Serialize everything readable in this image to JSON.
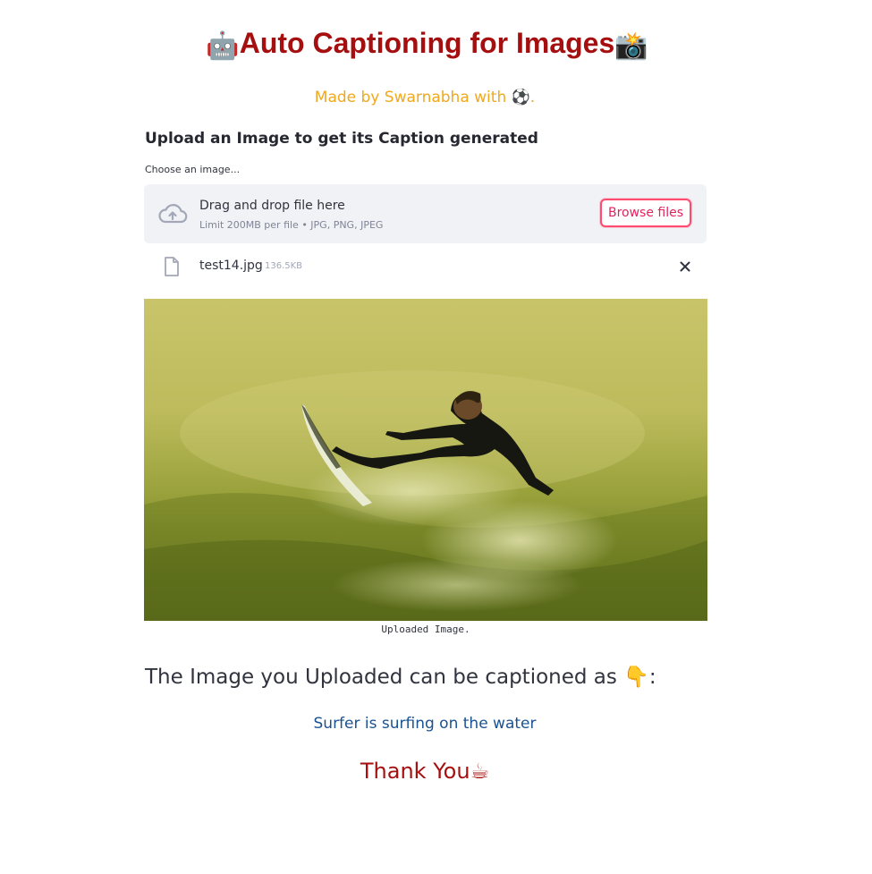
{
  "header": {
    "title_emoji_left": "🤖",
    "title": "Auto Captioning for Images",
    "title_emoji_right": "📸",
    "subtitle": "Made by Swarnabha with ⚽."
  },
  "uploader": {
    "heading": "Upload an Image to get its Caption generated",
    "label": "Choose an image...",
    "drop_text": "Drag and drop file here",
    "limit_text": "Limit 200MB per file • JPG, PNG, JPEG",
    "browse_label": "Browse files",
    "icons": {
      "upload": "cloud-upload-icon",
      "file": "file-icon",
      "remove": "close-icon"
    }
  },
  "file": {
    "name": "test14.jpg",
    "size": "136.5KB"
  },
  "image": {
    "caption": "Uploaded Image."
  },
  "result": {
    "heading": "The Image you Uploaded can be captioned as 👇:",
    "caption": "Surfer is surfing on the water",
    "thanks": "Thank You☕"
  },
  "colors": {
    "title": "#a50f0f",
    "subtitle": "#f0a81e",
    "accent": "#ff4b6e",
    "result_caption": "#1a5290",
    "dropzone_bg": "#f0f2f6"
  }
}
